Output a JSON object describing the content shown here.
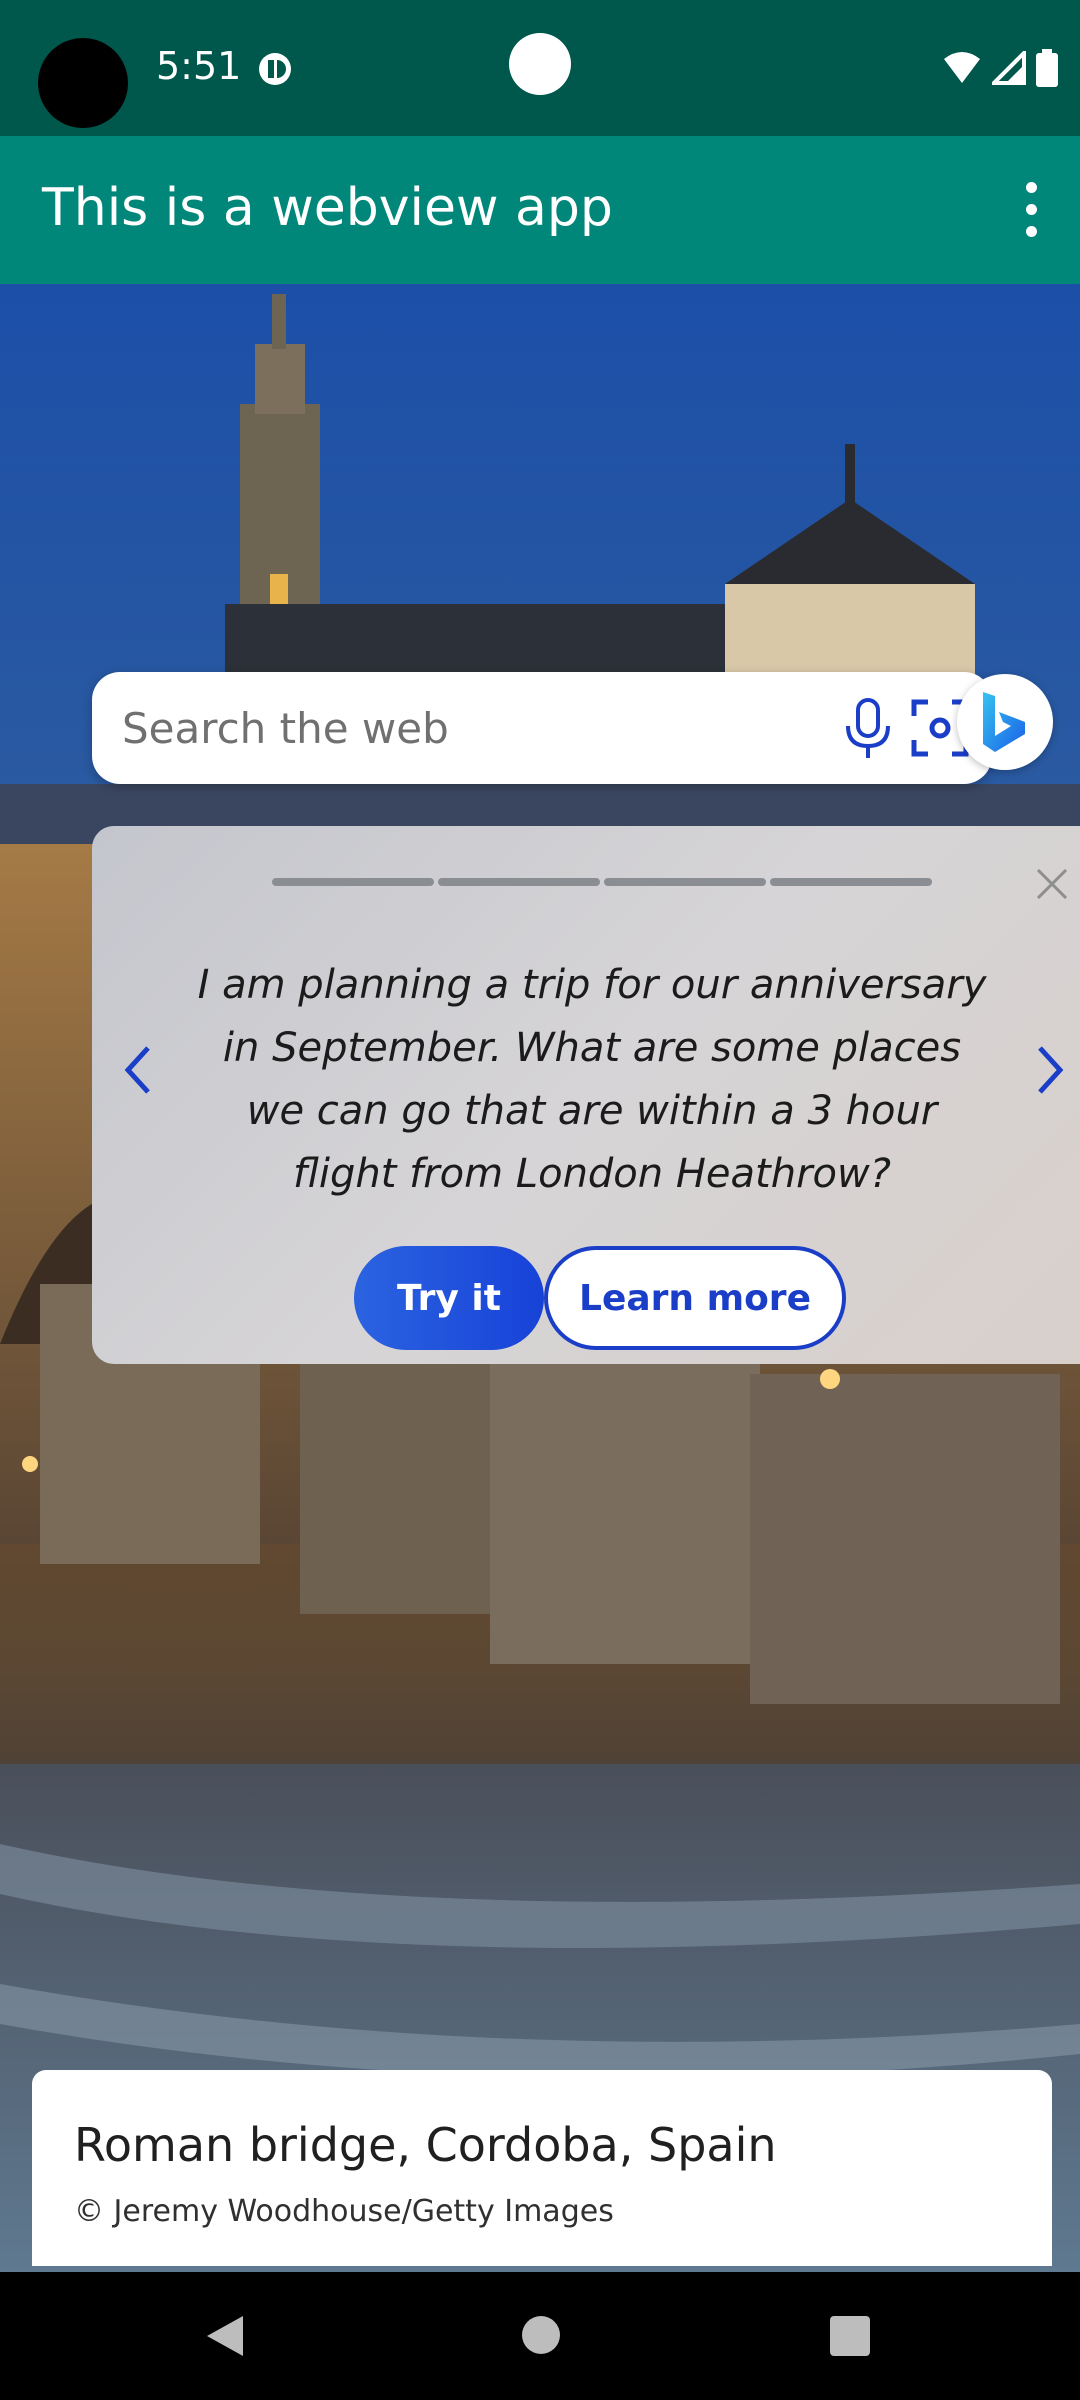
{
  "status_bar": {
    "time": "5:51"
  },
  "app_bar": {
    "title": "This is a webview app"
  },
  "search": {
    "placeholder": "Search the web"
  },
  "prompt_card": {
    "text": "I am planning a trip for our anniversary in September. What are some places we can go that are within a 3 hour flight from London Heathrow?",
    "try_label": "Try it",
    "learn_label": "Learn more",
    "progress_segments": 4,
    "accent_color": "#1a3ec8"
  },
  "caption": {
    "title": "Roman bridge, Cordoba, Spain",
    "credit": "© Jeremy Woodhouse/Getty Images"
  },
  "colors": {
    "status_bar": "#00574b",
    "app_bar": "#00877a"
  }
}
